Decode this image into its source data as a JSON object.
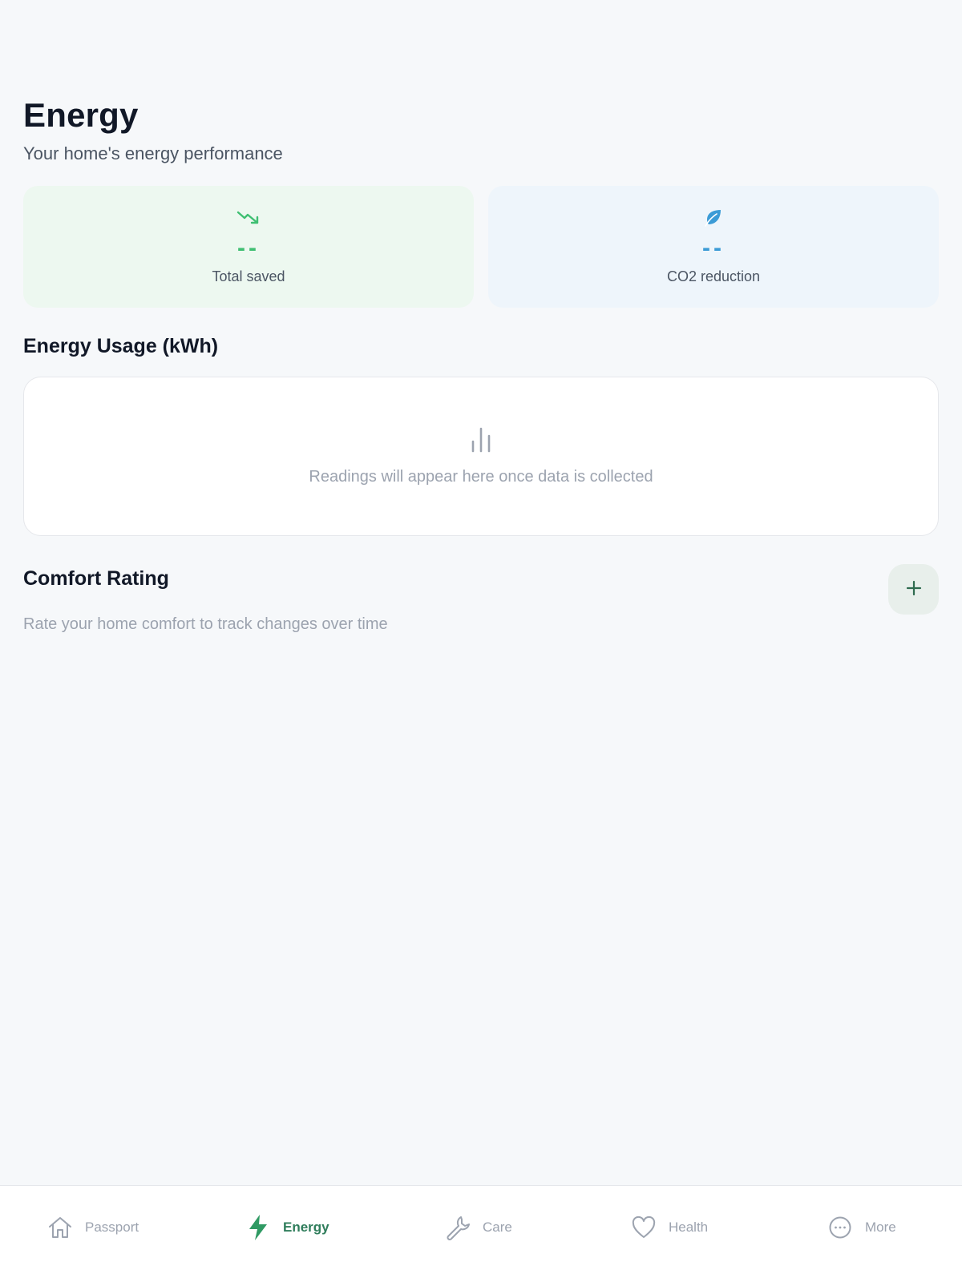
{
  "header": {
    "title": "Energy",
    "subtitle": "Your home's energy performance"
  },
  "stats": [
    {
      "icon": "trending-down-icon",
      "value": "--",
      "label": "Total saved",
      "color": "#3fbf72"
    },
    {
      "icon": "leaf-icon",
      "value": "--",
      "label": "CO2 reduction",
      "color": "#3b9bd6"
    }
  ],
  "usage": {
    "title": "Energy Usage (kWh)",
    "empty_icon": "bar-chart-icon",
    "empty_text": "Readings will appear here once data is collected"
  },
  "comfort": {
    "title": "Comfort Rating",
    "add_icon": "plus-icon",
    "subtitle": "Rate your home comfort to track changes over time"
  },
  "nav": {
    "active": "Energy",
    "items": [
      {
        "label": "Passport",
        "icon": "home-icon"
      },
      {
        "label": "Energy",
        "icon": "bolt-icon"
      },
      {
        "label": "Care",
        "icon": "wrench-icon"
      },
      {
        "label": "Health",
        "icon": "heart-icon"
      },
      {
        "label": "More",
        "icon": "more-dots-icon"
      }
    ]
  },
  "colors": {
    "accent": "#2f7d5b",
    "saved_green": "#3fbf72",
    "co2_blue": "#3b9bd6",
    "background": "#f6f8fa"
  }
}
